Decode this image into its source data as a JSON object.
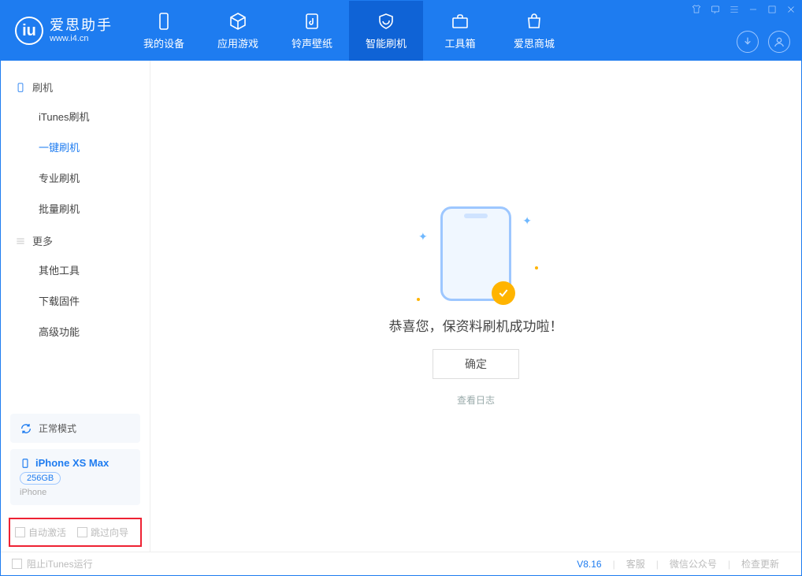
{
  "app": {
    "name": "爱思助手",
    "url": "www.i4.cn"
  },
  "tabs": {
    "device": "我的设备",
    "apps": "应用游戏",
    "ringtone": "铃声壁纸",
    "flash": "智能刷机",
    "toolbox": "工具箱",
    "store": "爱思商城"
  },
  "sidebar": {
    "section_flash": "刷机",
    "items_flash": {
      "itunes": "iTunes刷机",
      "oneclick": "一键刷机",
      "pro": "专业刷机",
      "batch": "批量刷机"
    },
    "section_more": "更多",
    "items_more": {
      "other": "其他工具",
      "firmware": "下载固件",
      "advanced": "高级功能"
    }
  },
  "device": {
    "mode": "正常模式",
    "name": "iPhone XS Max",
    "capacity": "256GB",
    "type": "iPhone"
  },
  "options": {
    "auto_activate": "自动激活",
    "skip_guide": "跳过向导"
  },
  "main": {
    "success_msg": "恭喜您，保资料刷机成功啦！",
    "ok": "确定",
    "view_log": "查看日志"
  },
  "footer": {
    "block_itunes": "阻止iTunes运行",
    "version": "V8.16",
    "support": "客服",
    "wechat": "微信公众号",
    "update": "检查更新"
  }
}
